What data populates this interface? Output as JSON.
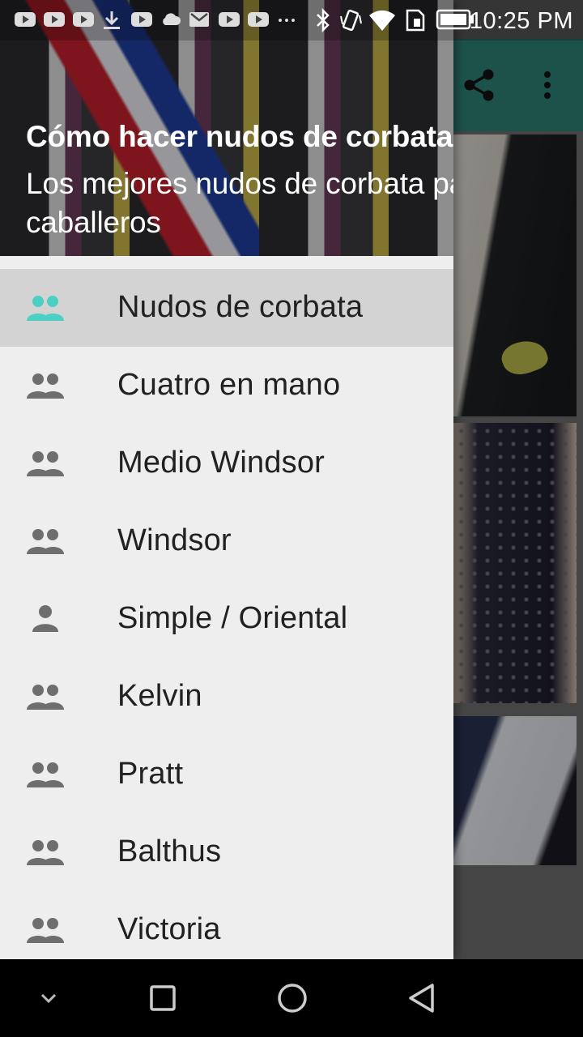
{
  "status_bar": {
    "time": "10:25 PM",
    "notification_icons": [
      "youtube-icon",
      "youtube-icon",
      "youtube-icon",
      "download-icon",
      "youtube-icon",
      "cloud-icon",
      "gmail-icon",
      "youtube-icon",
      "youtube-icon",
      "more-notifications-icon"
    ],
    "system_icons": [
      "bluetooth-icon",
      "vibrate-icon",
      "wifi-icon",
      "sim-icon",
      "battery-icon"
    ]
  },
  "toolbar": {
    "color": "#2d7f74",
    "share_icon": "share-icon",
    "more_icon": "more-vert-icon"
  },
  "drawer": {
    "title": "Cómo hacer nudos de corbata",
    "subtitle": "Los mejores nudos de corbata para caballeros",
    "accent_color": "#4dd0c4",
    "items": [
      {
        "label": "Nudos de corbata",
        "icon": "group-icon",
        "selected": true
      },
      {
        "label": "Cuatro en mano",
        "icon": "group-icon"
      },
      {
        "label": "Medio Windsor",
        "icon": "group-icon"
      },
      {
        "label": "Windsor",
        "icon": "group-icon"
      },
      {
        "label": "Simple / Oriental",
        "icon": "person-icon"
      },
      {
        "label": "Kelvin",
        "icon": "group-icon"
      },
      {
        "label": "Pratt",
        "icon": "group-icon"
      },
      {
        "label": "Balthus",
        "icon": "group-icon"
      },
      {
        "label": "Victoria",
        "icon": "group-icon"
      }
    ]
  },
  "nav_bar": {
    "buttons": [
      "hide-nav-icon",
      "recents-icon",
      "home-icon",
      "back-icon"
    ]
  }
}
